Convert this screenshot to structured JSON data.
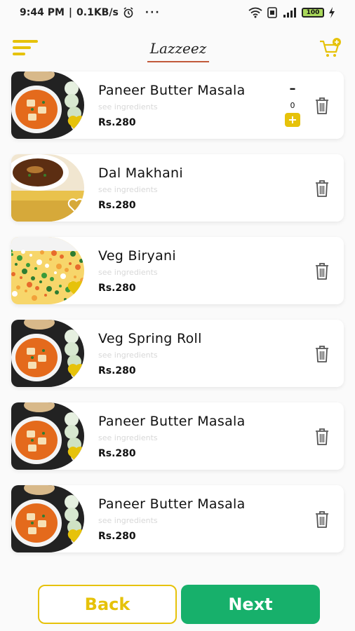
{
  "status_bar": {
    "time": "9:44 PM",
    "speed": "0.1KB/s",
    "battery": "100"
  },
  "header": {
    "logo_text": "Lazzeez"
  },
  "items": [
    {
      "name": "Paneer Butter Masala",
      "ingredients_link": "see ingredients",
      "price": "Rs.280",
      "quantity": "0",
      "liked": true,
      "image": "paneer-dish"
    },
    {
      "name": "Dal Makhani",
      "ingredients_link": "see ingredients",
      "price": "Rs.280",
      "liked": false,
      "image": "dal-dish"
    },
    {
      "name": "Veg Biryani",
      "ingredients_link": "see ingredients",
      "price": "Rs.280",
      "liked": true,
      "image": "biryani-dish"
    },
    {
      "name": "Veg Spring Roll",
      "ingredients_link": "see ingredients",
      "price": "Rs.280",
      "liked": true,
      "image": "paneer-dish"
    },
    {
      "name": "Paneer Butter Masala",
      "ingredients_link": "see ingredients",
      "price": "Rs.280",
      "liked": true,
      "image": "paneer-dish"
    },
    {
      "name": "Paneer Butter Masala",
      "ingredients_link": "see ingredients",
      "price": "Rs.280",
      "liked": true,
      "image": "paneer-dish"
    }
  ],
  "quantity_controls": {
    "minus": "–",
    "plus": "+"
  },
  "actions": {
    "back_label": "Back",
    "next_label": "Next"
  },
  "colors": {
    "accent_yellow": "#e6c20a",
    "next_green": "#17b06b",
    "logo_underline": "#c25a3a"
  }
}
